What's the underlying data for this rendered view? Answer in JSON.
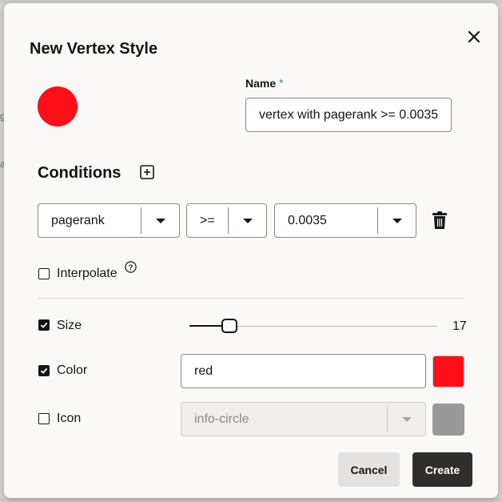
{
  "dialog": {
    "title": "New Vertex Style",
    "close_icon": "close-icon"
  },
  "preview": {
    "color": "#fe0f1a"
  },
  "name_field": {
    "label": "Name",
    "required_marker": "*",
    "value": "vertex with pagerank >= 0.0035"
  },
  "conditions": {
    "title": "Conditions",
    "add_icon": "plus-square-icon",
    "rows": [
      {
        "property": "pagerank",
        "operator": ">=",
        "value": "0.0035",
        "delete_icon": "trash-icon"
      }
    ]
  },
  "interpolate": {
    "label": "Interpolate",
    "checked": false,
    "help_icon": "help-circle-icon"
  },
  "size": {
    "label": "Size",
    "checked": true,
    "value": "17",
    "fraction": 0.16
  },
  "color": {
    "label": "Color",
    "checked": true,
    "value": "red",
    "swatch": "#fe0f1a"
  },
  "icon": {
    "label": "Icon",
    "checked": false,
    "value": "info-circle",
    "swatch": "#999999"
  },
  "footer": {
    "cancel_label": "Cancel",
    "create_label": "Create"
  },
  "colors": {
    "accent_required": "#0572ce",
    "primary_button": "#312d2a",
    "secondary_button": "#e4e1de"
  }
}
